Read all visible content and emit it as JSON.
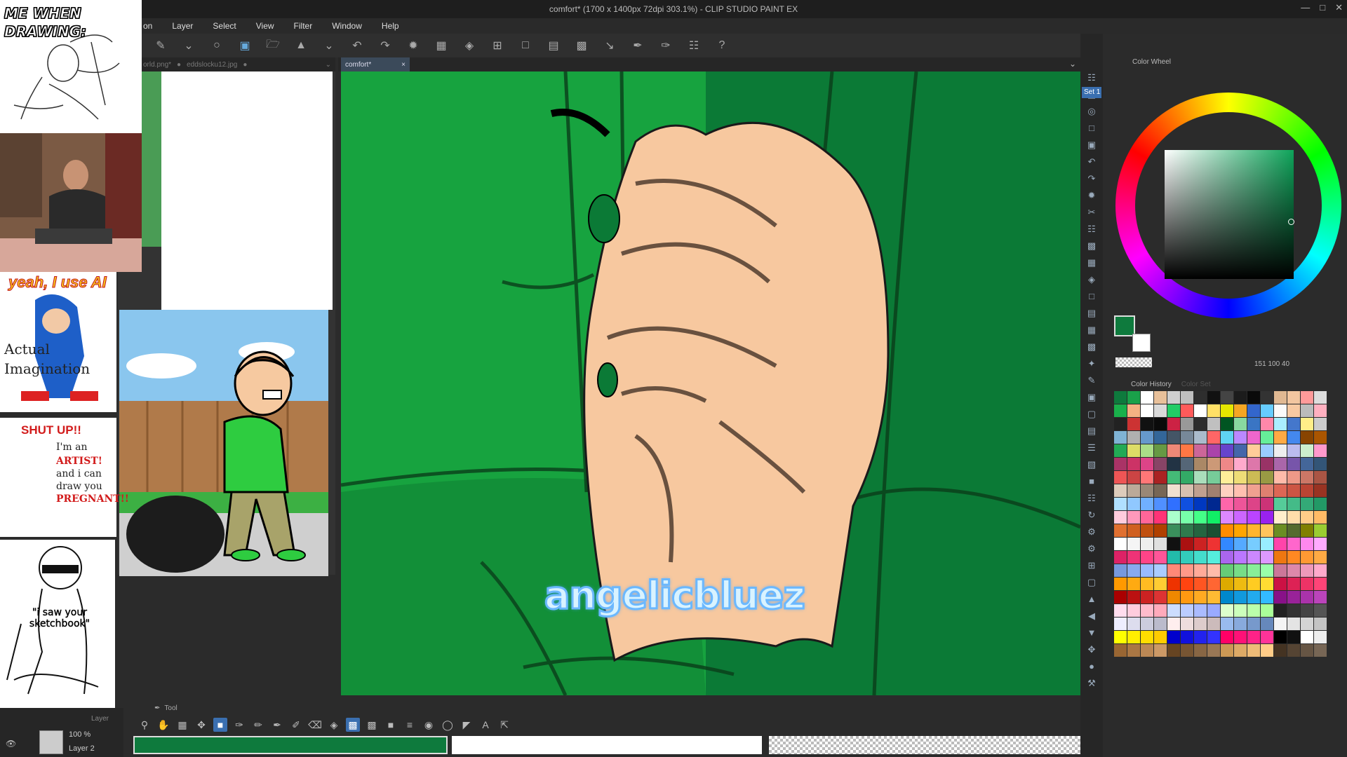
{
  "window": {
    "title": "comfort* (1700 x 1400px 72dpi 303.1%) - CLIP STUDIO PAINT EX"
  },
  "menu": [
    "on",
    "Layer",
    "Select",
    "View",
    "Filter",
    "Window",
    "Help"
  ],
  "tabs": {
    "left": [
      "orld.png*",
      "eddslocku12.jpg"
    ],
    "active": "comfort*"
  },
  "canvas": {
    "watermark": "angelicbluez"
  },
  "overlays": {
    "meme1_caption": "ME WHEN DRAWING:",
    "meme2_title": "yeah, I use AI",
    "meme2_body": "Actual Imagination",
    "meme3_shout": "SHUT UP!!",
    "meme3_lines": [
      "I'm an",
      "ARTIST!",
      "and i can",
      "draw you",
      "PREGNANT!!"
    ],
    "meme4_caption": "\"i saw your sketchbook\""
  },
  "layer_panel": {
    "opacity": "100 %",
    "layer_name": "Layer 2",
    "label": "Layer"
  },
  "tool_panel": {
    "label": "Tool"
  },
  "color_wheel": {
    "title": "Color Wheel",
    "set_label": "Set 1",
    "values": "151  100  40",
    "main_color": "#0e7a3d",
    "sub_color": "#ffffff"
  },
  "color_history": {
    "tab_active": "Color History",
    "tab_inactive": "Color Set",
    "colors": [
      "#0e7a3d",
      "#1aa14a",
      "#ffffff",
      "#e8c09a",
      "#cfcfcf",
      "#bfbfbf",
      "#2e2e2e",
      "#111111",
      "#444444",
      "#1c1c1c",
      "#0a0a0a",
      "#333333",
      "#e0b892",
      "#f2c6a0",
      "#ff9a9a",
      "#dddddd",
      "#19b04b",
      "#f4b183",
      "#ffffff",
      "#d9d9d9",
      "#22cc66",
      "#ff5a5a",
      "#ffffff",
      "#ffe066",
      "#e6e600",
      "#f5a623",
      "#3366cc",
      "#66ccff",
      "#fafafa",
      "#f7c9a2",
      "#bbbbbb",
      "#ffb0c0",
      "#222222",
      "#cc3333",
      "#111111",
      "#0a0a0a",
      "#cc2244",
      "#999999",
      "#2d2d2d",
      "#c0c0c0",
      "#005522",
      "#88d8a0",
      "#3a75c4",
      "#ff88aa",
      "#aaeeff",
      "#4477cc",
      "#ffee88",
      "#cccccc",
      "#7fb3d5",
      "#b0b0b0",
      "#6699cc",
      "#336699",
      "#445566",
      "#778899",
      "#aabbcc",
      "#ff6666",
      "#5fd3f3",
      "#bb88ff",
      "#ee66cc",
      "#66ee99",
      "#ffaa44",
      "#4488ee",
      "#884400",
      "#aa5500",
      "#22aa55",
      "#dddd66",
      "#aadd88",
      "#669944",
      "#ee8877",
      "#ff7744",
      "#cc6699",
      "#aa44aa",
      "#6644cc",
      "#4466aa",
      "#ffcc99",
      "#99ccff",
      "#eeeeee",
      "#bbbbee",
      "#cceecc",
      "#ff99cc",
      "#aa3366",
      "#cc3366",
      "#dd4488",
      "#884466",
      "#223344",
      "#556677",
      "#aa8866",
      "#cc9977",
      "#ee8888",
      "#ffaacc",
      "#dd77aa",
      "#993366",
      "#aa66aa",
      "#7755aa",
      "#446699",
      "#335577",
      "#ee5555",
      "#cc4444",
      "#ff7777",
      "#aa2222",
      "#44bb77",
      "#33aa66",
      "#aaddbb",
      "#77cc99",
      "#ffee99",
      "#eedd77",
      "#ccbb55",
      "#999944",
      "#ffbbaa",
      "#ee9988",
      "#cc7766",
      "#aa5544",
      "#ddccbb",
      "#bbaa99",
      "#998877",
      "#776655",
      "#f0e0d0",
      "#d8c0b0",
      "#c0a090",
      "#a08070",
      "#ffd0c0",
      "#ffc0b0",
      "#f0a090",
      "#e08070",
      "#dd6655",
      "#cc5544",
      "#bb4433",
      "#993322",
      "#b0e0ff",
      "#90c8ff",
      "#70b0ff",
      "#5090ff",
      "#3070ff",
      "#1050e0",
      "#0038c0",
      "#002890",
      "#ff66aa",
      "#ee5599",
      "#dd4488",
      "#cc3377",
      "#55cc99",
      "#44bb88",
      "#33aa77",
      "#229966",
      "#ffccdd",
      "#ff99bb",
      "#ff6699",
      "#ff3377",
      "#aaffcc",
      "#77ffaa",
      "#44ff88",
      "#11ee66",
      "#dd88ff",
      "#cc66ff",
      "#bb44ff",
      "#9922ee",
      "#ffeecc",
      "#ffddaa",
      "#ffcc88",
      "#ffbb66",
      "#e07030",
      "#d06020",
      "#c05010",
      "#b04000",
      "#3a8f5c",
      "#2f7a4d",
      "#246540",
      "#1a5033",
      "#ff8c00",
      "#ffa500",
      "#ffb52e",
      "#ffc55c",
      "#6b8e23",
      "#556b2f",
      "#808000",
      "#9acd32",
      "#ffffff",
      "#f5f5f5",
      "#eeeeee",
      "#e0e0e0",
      "#111111",
      "#aa1111",
      "#cc2222",
      "#ee3333",
      "#3388ff",
      "#55aaff",
      "#77ccff",
      "#99eeff",
      "#ff44aa",
      "#ff66cc",
      "#ff88ee",
      "#ffaaff",
      "#dd2266",
      "#ee3377",
      "#ff4488",
      "#ff5599",
      "#22bbaa",
      "#33ccbb",
      "#44ddcc",
      "#55eedd",
      "#aa66ee",
      "#bb77ff",
      "#cc88ff",
      "#dd99ff",
      "#ee7711",
      "#ff8822",
      "#ff9933",
      "#ffaa44",
      "#7799dd",
      "#88aaee",
      "#99bbff",
      "#aaccff",
      "#ff8877",
      "#ff9988",
      "#ffaa99",
      "#ffbbaa",
      "#66cc77",
      "#77dd88",
      "#88ee99",
      "#99ffaa",
      "#cc7799",
      "#dd88aa",
      "#ee99bb",
      "#ffaacc",
      "#ff9900",
      "#ffaa11",
      "#ffbb22",
      "#ffcc33",
      "#ee3300",
      "#ff4411",
      "#ff5522",
      "#ff6633",
      "#ddaa00",
      "#eebb11",
      "#ffcc22",
      "#ffdd33",
      "#cc1144",
      "#dd2255",
      "#ee3366",
      "#ff4477",
      "#aa0000",
      "#bb1111",
      "#cc2222",
      "#dd3333",
      "#ee8800",
      "#ff9911",
      "#ffaa22",
      "#ffbb33",
      "#0088cc",
      "#1199dd",
      "#22aaee",
      "#33bbff",
      "#881188",
      "#992299",
      "#aa33aa",
      "#bb44bb",
      "#ffddee",
      "#ffccdd",
      "#ffbbcc",
      "#ffaabb",
      "#ccddff",
      "#bbccff",
      "#aabbff",
      "#99aaff",
      "#ddffcc",
      "#ccffbb",
      "#bbffaa",
      "#aaff99",
      "#222222",
      "#333333",
      "#444444",
      "#555555",
      "#eeeeff",
      "#ddddee",
      "#ccccdd",
      "#bbbbcc",
      "#ffeeee",
      "#eedddd",
      "#ddcccc",
      "#ccbbbb",
      "#99bbee",
      "#88aadd",
      "#7799cc",
      "#6688bb",
      "#f4f4f4",
      "#e4e4e4",
      "#d4d4d4",
      "#c4c4c4",
      "#ffff00",
      "#ffee00",
      "#ffdd00",
      "#ffcc00",
      "#0000cc",
      "#1111dd",
      "#2222ee",
      "#3333ff",
      "#ff0066",
      "#ff1177",
      "#ff2288",
      "#ff3399",
      "#000000",
      "#111111",
      "#ffffff",
      "#eeeeee",
      "#996633",
      "#aa7744",
      "#bb8855",
      "#cc9966",
      "#664422",
      "#775533",
      "#886644",
      "#997755",
      "#cc9955",
      "#ddaa66",
      "#eebb77",
      "#ffcc88",
      "#443322",
      "#554433",
      "#665544",
      "#776655"
    ]
  }
}
